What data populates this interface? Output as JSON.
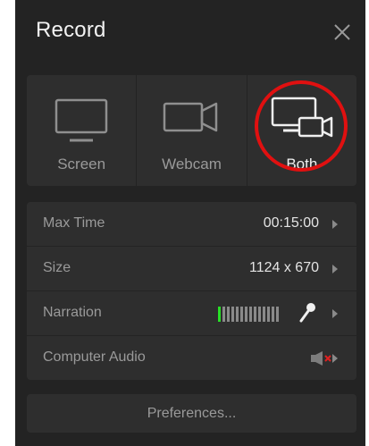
{
  "window": {
    "title": "Record"
  },
  "modes": [
    {
      "label": "Screen",
      "icon": "monitor-icon"
    },
    {
      "label": "Webcam",
      "icon": "webcam-icon"
    },
    {
      "label": "Both",
      "icon": "screen-and-webcam-icon",
      "selected": true
    }
  ],
  "settings": {
    "max_time": {
      "label": "Max Time",
      "value": "00:15:00"
    },
    "size": {
      "label": "Size",
      "value": "1124 x 670"
    },
    "narration": {
      "label": "Narration",
      "level": 0.1,
      "icon": "microphone-icon"
    },
    "computer_audio": {
      "label": "Computer Audio",
      "icon": "speaker-muted-icon"
    }
  },
  "preferences_label": "Preferences...",
  "colors": {
    "window_bg": "#232323",
    "panel_bg": "#2e2e2e",
    "meter_active": "#27e026",
    "highlight_ring": "#e01010",
    "mute_x": "#e02020"
  }
}
